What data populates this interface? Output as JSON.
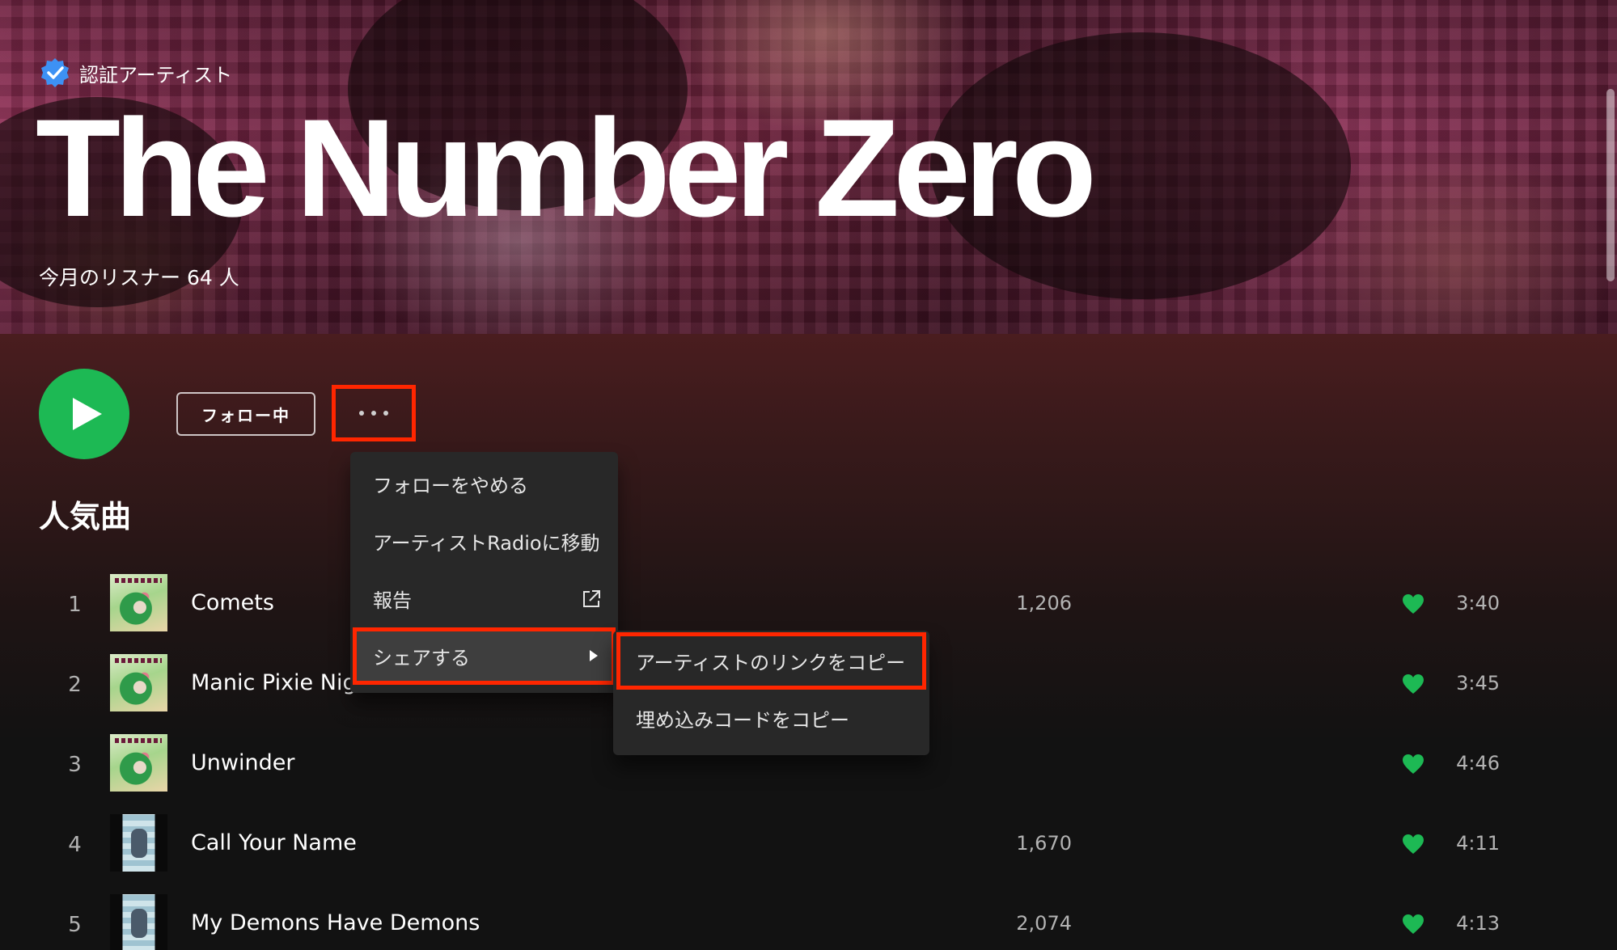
{
  "header": {
    "verified_label": "認証アーティスト",
    "artist_name": "The Number Zero",
    "monthly_listeners": "今月のリスナー 64 人"
  },
  "actions": {
    "follow_label": "フォロー中"
  },
  "section": {
    "title": "人気曲"
  },
  "tracks": [
    {
      "num": "1",
      "title": "Comets",
      "plays": "1,206",
      "duration": "3:40",
      "cover": "green"
    },
    {
      "num": "2",
      "title": "Manic Pixie Nig",
      "plays": "",
      "duration": "3:45",
      "cover": "green"
    },
    {
      "num": "3",
      "title": "Unwinder",
      "plays": "",
      "duration": "4:46",
      "cover": "green"
    },
    {
      "num": "4",
      "title": "Call Your Name",
      "plays": "1,670",
      "duration": "4:11",
      "cover": "dark"
    },
    {
      "num": "5",
      "title": "My Demons Have Demons",
      "plays": "2,074",
      "duration": "4:13",
      "cover": "dark"
    }
  ],
  "context_menu": {
    "items": [
      "フォローをやめる",
      "アーティストRadioに移動",
      "報告",
      "シェアする"
    ]
  },
  "submenu": {
    "items": [
      "アーティストのリンクをコピー",
      "埋め込みコードをコピー"
    ]
  },
  "colors": {
    "accent": "#1db954",
    "highlight_outline": "#ff2600",
    "menu_bg": "#282828"
  }
}
